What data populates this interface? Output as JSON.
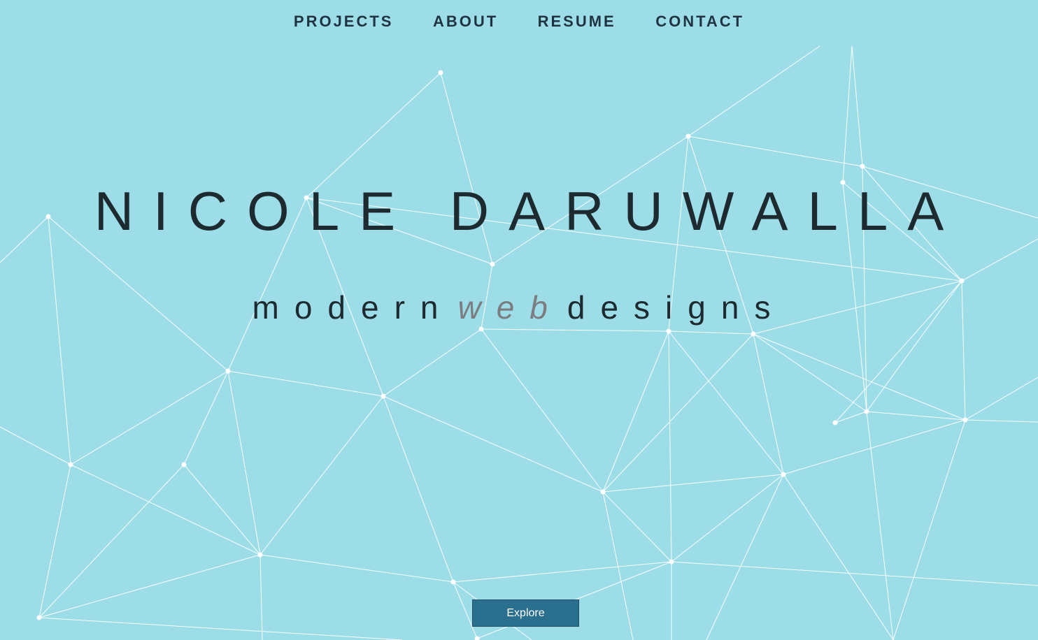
{
  "nav": {
    "items": [
      "PROJECTS",
      "ABOUT",
      "RESUME",
      "CONTACT"
    ]
  },
  "hero": {
    "title": "NICOLE DARUWALLA",
    "tagline_prefix": "modern",
    "tagline_accent": "web",
    "tagline_suffix": "designs",
    "button_label": "Explore"
  },
  "colors": {
    "background": "#9ddde7",
    "text": "#1d2a30",
    "accent_text": "#7b7d80",
    "button": "#2b6f8f"
  }
}
